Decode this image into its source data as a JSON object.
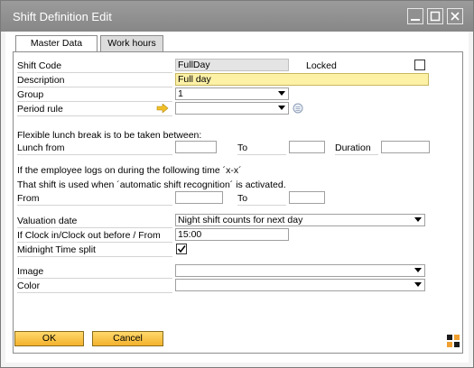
{
  "window": {
    "title": "Shift Definition Edit"
  },
  "tabs": [
    {
      "label": "Master Data"
    },
    {
      "label": "Work hours"
    }
  ],
  "fields": {
    "shift_code": {
      "label": "Shift Code",
      "value": "FullDay"
    },
    "locked": {
      "label": "Locked",
      "checked": false
    },
    "description": {
      "label": "Description",
      "value": "Full day"
    },
    "group": {
      "label": "Group",
      "value": "1"
    },
    "period_rule": {
      "label": "Period rule",
      "value": ""
    }
  },
  "break_section": {
    "heading": "Flexible lunch break is to be taken between:",
    "lunch_from": {
      "label": "Lunch from",
      "value": ""
    },
    "to": {
      "label": "To",
      "value": ""
    },
    "duration": {
      "label": "Duration",
      "value": ""
    }
  },
  "recognition_section": {
    "line1": "If the employee logs on during the following time ´x-x´",
    "line2": "That shift is used when ´automatic shift recognition´ is activated.",
    "from": {
      "label": "From",
      "value": ""
    },
    "to": {
      "label": "To",
      "value": ""
    }
  },
  "valuation": {
    "valuation_date": {
      "label": "Valuation date",
      "value": "Night shift counts for next day"
    },
    "clock": {
      "label": "If Clock in/Clock out before / From",
      "value": "15:00"
    },
    "midnight": {
      "label": "Midnight Time split",
      "checked": true
    }
  },
  "appearance": {
    "image": {
      "label": "Image",
      "value": ""
    },
    "color": {
      "label": "Color",
      "value": ""
    }
  },
  "buttons": {
    "ok": "OK",
    "cancel": "Cancel"
  },
  "colors": {
    "title_bar": "#909090",
    "button": "#f3b22c",
    "highlight_field": "#fdf1a6",
    "brand_icon": "#f0a030"
  }
}
